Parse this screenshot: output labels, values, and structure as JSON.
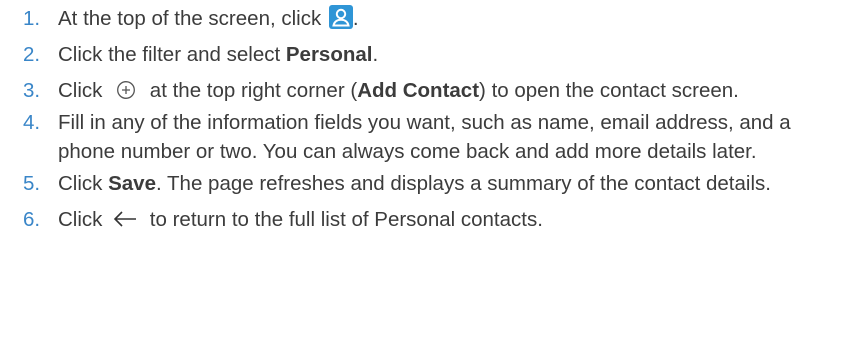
{
  "steps": [
    {
      "number": "1.",
      "text_before": "At the top of the screen, click ",
      "icon": "contact-icon",
      "text_after": "."
    },
    {
      "number": "2.",
      "text_before": "Click the filter and select ",
      "bold": "Personal",
      "text_after": "."
    },
    {
      "number": "3.",
      "text_before": "Click ",
      "icon": "add-circle-icon",
      "text_mid": " at the top right corner (",
      "bold": "Add Contact",
      "text_after": ") to open the contact screen."
    },
    {
      "number": "4.",
      "text": "Fill in any of the information fields you want, such as name, email address, and a phone number or two. You can always come back and add more details later."
    },
    {
      "number": "5.",
      "text_before": "Click ",
      "bold": "Save",
      "text_after": ". The page refreshes and displays a summary of the contact details."
    },
    {
      "number": "6.",
      "text_before": "Click ",
      "icon": "back-arrow-icon",
      "text_after": " to return to the full list of Personal contacts."
    }
  ],
  "colors": {
    "number": "#3a86c8",
    "text": "#3c3c3c",
    "contact_icon_bg": "#2f95d6"
  }
}
